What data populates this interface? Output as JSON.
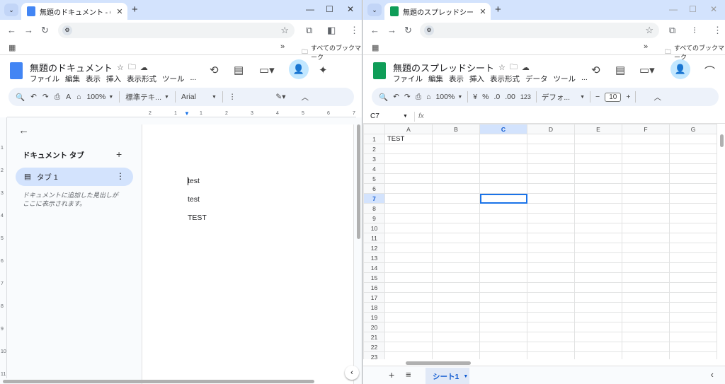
{
  "left": {
    "tab_title": "無題のドキュメント - Google ドキュ",
    "doc_title": "無題のドキュメント",
    "menu": [
      "ファイル",
      "編集",
      "表示",
      "挿入",
      "表示形式",
      "ツール",
      "..."
    ],
    "toolbar": {
      "zoom": "100%",
      "style": "標準テキ...",
      "font": "Arial"
    },
    "bookmarks_label": "すべてのブックマーク",
    "sidebar": {
      "heading": "ドキュメント タブ",
      "tab_label": "タブ 1",
      "hint": "ドキュメントに追加した見出しがここに表示されます。"
    },
    "ruler_h": [
      "2",
      "1",
      "1",
      "2",
      "3",
      "4",
      "5",
      "6",
      "7"
    ],
    "ruler_v": [
      "1",
      "2",
      "3",
      "4",
      "5",
      "6",
      "7",
      "8",
      "9",
      "10",
      "11"
    ],
    "lines": [
      "test",
      "test",
      "TEST"
    ]
  },
  "right": {
    "tab_title": "無題のスプレッドシート - Google ス",
    "doc_title": "無題のスプレッドシート",
    "menu": [
      "ファイル",
      "編集",
      "表示",
      "挿入",
      "表示形式",
      "データ",
      "ツール",
      "..."
    ],
    "toolbar": {
      "zoom": "100%",
      "currency": "¥",
      "percent": "%",
      "dec_minus": ".0",
      "dec_plus": ".00",
      "num": "123",
      "font": "デフォ...",
      "size": "10"
    },
    "bookmarks_label": "すべてのブックマーク",
    "namebox": "C7",
    "fx": "fx",
    "columns": [
      "A",
      "B",
      "C",
      "D",
      "E",
      "F",
      "G"
    ],
    "selected_col": "C",
    "selected_row": 7,
    "rows": 23,
    "cells": {
      "A1": "TEST"
    },
    "sheet_name": "シート1"
  },
  "colors": {
    "docs_blue": "#4285f4",
    "sheets_green": "#0f9d58",
    "tab_strip": "#d3e3fd",
    "accent": "#1a73e8"
  }
}
